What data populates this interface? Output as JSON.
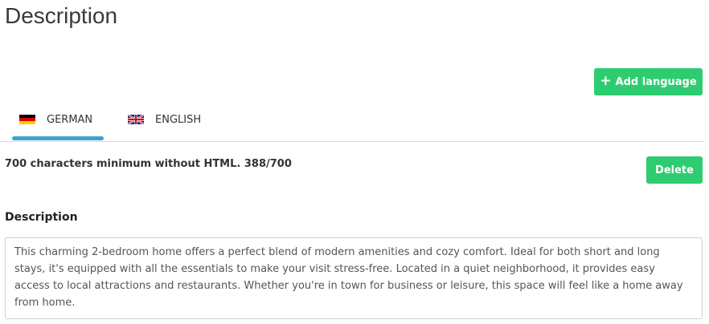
{
  "header": {
    "title": "Description"
  },
  "toolbar": {
    "add_language_label": "Add language",
    "add_language_icon": "plus-icon"
  },
  "tabs": [
    {
      "label": "GERMAN",
      "flag": "germany-flag-icon",
      "active": true
    },
    {
      "label": "ENGLISH",
      "flag": "uk-flag-icon",
      "active": false
    }
  ],
  "editor": {
    "hint": "700 characters minimum without HTML. 388/700",
    "delete_label": "Delete",
    "field_label": "Description",
    "value": "This charming 2-bedroom home offers a perfect blend of modern amenities and cozy comfort. Ideal for both short and long stays, it's equipped with all the essentials to make your visit stress-free. Located in a quiet neighborhood, it provides easy access to local attractions and restaurants. Whether you're in town for business or leisure, this space will feel like a home away from home."
  },
  "colors": {
    "accent_green": "#2ecc71",
    "tab_underline": "#3aa3cf"
  }
}
